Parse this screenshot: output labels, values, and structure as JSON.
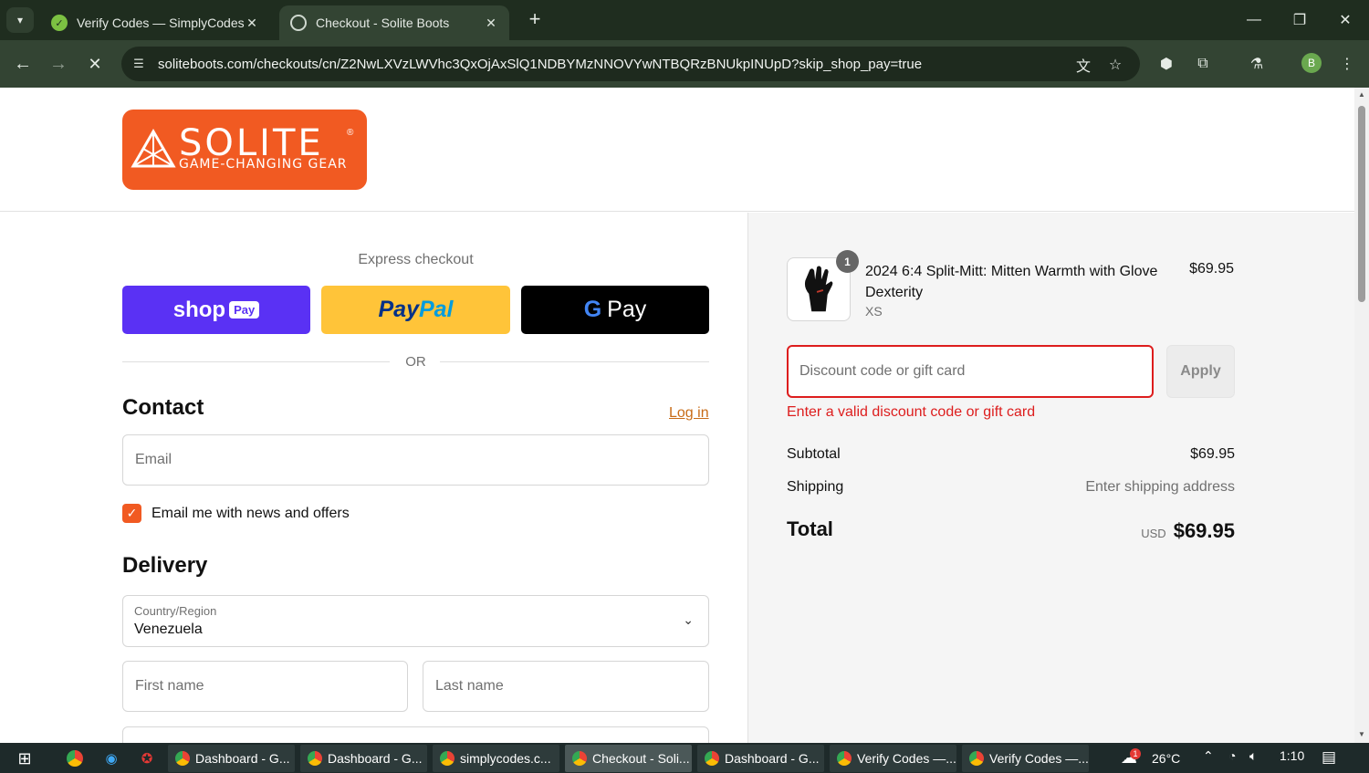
{
  "browser": {
    "tabs": [
      {
        "title": "Verify Codes — SimplyCodes",
        "active": false
      },
      {
        "title": "Checkout - Solite Boots",
        "active": true
      }
    ],
    "url": "soliteboots.com/checkouts/cn/Z2NwLXVzLWVhc3QxOjAxSlQ1NDBYMzNNOVYwNTBQRzBNUkpINUpD?skip_shop_pay=true",
    "profile_initial": "B"
  },
  "header": {
    "logo_brand": "SOLITE",
    "logo_tagline": "GAME-CHANGING GEAR",
    "logo_reg": "®"
  },
  "express": {
    "title": "Express checkout",
    "shop_label": "shop",
    "shop_badge": "Pay",
    "paypal_part1": "Pay",
    "paypal_part2": "Pal",
    "gpay_g": "G",
    "gpay_label": "Pay",
    "or_label": "OR"
  },
  "contact": {
    "title": "Contact",
    "login_link": "Log in",
    "email_placeholder": "Email",
    "newsletter_label": "Email me with news and offers",
    "newsletter_checked": true
  },
  "delivery": {
    "title": "Delivery",
    "country_label": "Country/Region",
    "country_value": "Venezuela",
    "first_name_placeholder": "First name",
    "last_name_placeholder": "Last name"
  },
  "summary": {
    "item": {
      "quantity": "1",
      "name": "2024 6:4 Split-Mitt: Mitten Warmth with Glove Dexterity",
      "variant": "XS",
      "price": "$69.95"
    },
    "discount_placeholder": "Discount code or gift card",
    "apply_label": "Apply",
    "discount_error": "Enter a valid discount code or gift card",
    "subtotal_label": "Subtotal",
    "subtotal_value": "$69.95",
    "shipping_label": "Shipping",
    "shipping_value": "Enter shipping address",
    "total_label": "Total",
    "total_currency": "USD",
    "total_value": "$69.95"
  },
  "taskbar": {
    "tasks": [
      {
        "label": "Dashboard - G...",
        "active": false
      },
      {
        "label": "Dashboard - G...",
        "active": false
      },
      {
        "label": "simplycodes.c...",
        "active": false
      },
      {
        "label": "Checkout - Soli...",
        "active": true
      },
      {
        "label": "Dashboard - G...",
        "active": false
      },
      {
        "label": "Verify Codes —...",
        "active": false
      },
      {
        "label": "Verify Codes —...",
        "active": false
      }
    ],
    "weather_badge": "1",
    "temperature": "26°C",
    "time": "1:10"
  },
  "colors": {
    "brand_orange": "#f15a22",
    "error_red": "#dd1d1d",
    "shop_purple": "#5a31f4",
    "paypal_yellow": "#ffc439"
  }
}
